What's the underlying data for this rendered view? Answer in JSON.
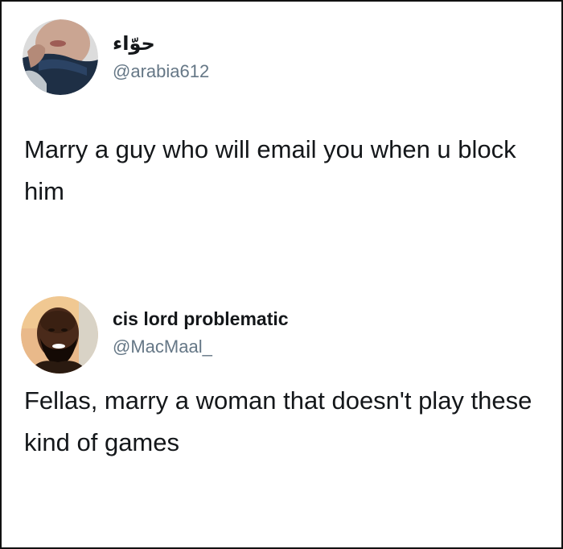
{
  "tweets": [
    {
      "display_name": "حوّاء",
      "handle": "@arabia612",
      "text": "Marry a guy who will email you when u block him",
      "avatar_icon": "profile-photo-woman"
    },
    {
      "display_name": "cis lord problematic",
      "handle": "@MacMaal_",
      "text": "Fellas, marry a woman that doesn't play these kind of games",
      "avatar_icon": "profile-photo-man"
    }
  ],
  "colors": {
    "text": "#14171a",
    "handle": "#657786",
    "border": "#111111",
    "background": "#ffffff"
  }
}
